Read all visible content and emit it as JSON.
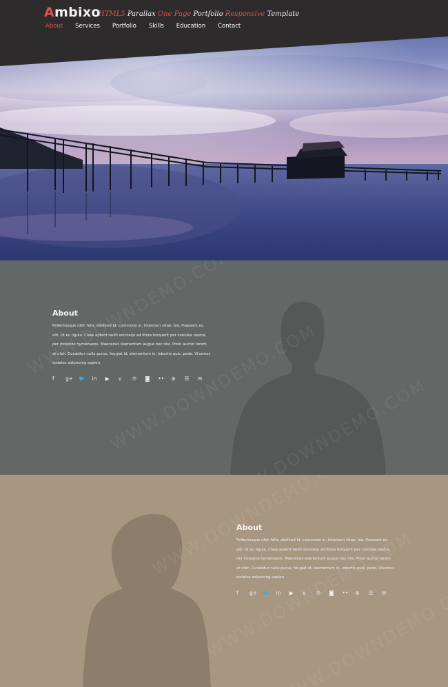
{
  "header": {
    "logo_first": "A",
    "logo_rest": "mbixo",
    "tagline_part1": "HTML5",
    "tagline_part2": " Parallax ",
    "tagline_part3": "One Page",
    "tagline_part4": " Portfolio ",
    "tagline_part5": "Responsive",
    "tagline_part6": " Template",
    "nav": [
      "About",
      "Services",
      "Portfolio",
      "Skills",
      "Education",
      "Contact"
    ]
  },
  "about_1": {
    "title": "About",
    "body": "Pellentesque nibh felis, eleifend id, commodo in, interdum vitae, leo. Praesent eu elit. Ut eu ligula. Class aptent taciti sociosqu ad litora torquent per conubia nostra, per inceptos hymenaeos. Maecenas elementum augue nec nisl. Proin auctor lorem at nibh. Curabitur nulla purus, feugiat id, elementum in, lobortis quis, pede. Vivamus sodales adipiscing sapien."
  },
  "about_2": {
    "title": "About",
    "body": "Pellentesque nibh felis, eleifend id, commodo in, interdum vitae, leo. Praesent eu elit. Ut eu ligula. Class aptent taciti sociosqu ad litora torquent per conubia nostra, per inceptos hymenaeos. Maecenas elementum augue nec nisl. Proin auctor lorem at nibh. Curabitur nulla purus, feugiat id, elementum in, lobortis quis, pede. Vivamus sodales adipiscing sapien."
  },
  "social_icons": [
    {
      "name": "facebook-icon",
      "glyph": "f"
    },
    {
      "name": "google-plus-icon",
      "glyph": "g+"
    },
    {
      "name": "twitter-icon",
      "glyph": "🐦"
    },
    {
      "name": "linkedin-icon",
      "glyph": "in"
    },
    {
      "name": "youtube-icon",
      "glyph": "▶"
    },
    {
      "name": "vimeo-icon",
      "glyph": "v"
    },
    {
      "name": "pinterest-icon",
      "glyph": "℗"
    },
    {
      "name": "instagram-icon",
      "glyph": "◙"
    },
    {
      "name": "flickr-icon",
      "glyph": "••"
    },
    {
      "name": "dribbble-icon",
      "glyph": "⊛"
    },
    {
      "name": "rss-icon",
      "glyph": "☰"
    },
    {
      "name": "email-icon",
      "glyph": "✉"
    }
  ],
  "watermark": "WWW.DOWNDEMO.COM",
  "colors": {
    "header_bg": "#2e2b2c",
    "accent": "#e0524a",
    "section_grey": "#636766",
    "section_tan": "#a89681"
  }
}
